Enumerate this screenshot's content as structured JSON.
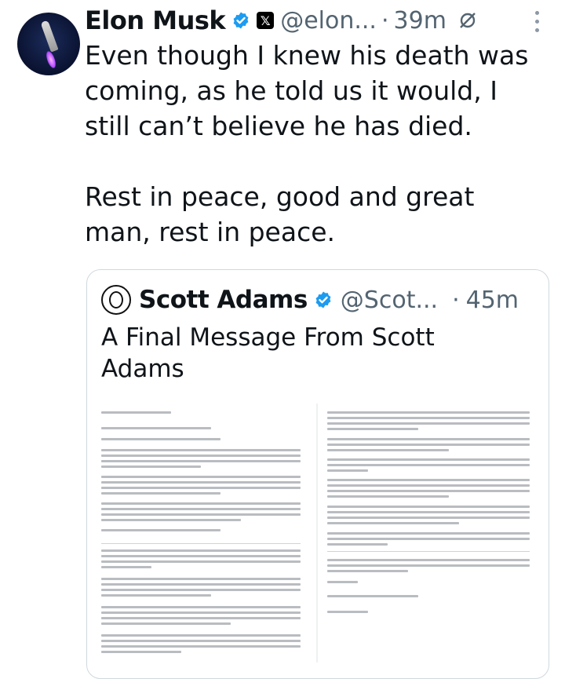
{
  "tweet": {
    "author_name": "Elon Musk",
    "handle": "@elon...",
    "separator": "·",
    "time": "39m",
    "text_lines": [
      "Even though I knew his death was coming, as he told us it would, I still can’t believe he has died.",
      "Rest in peace, good and great man, rest in peace."
    ],
    "icons": {
      "verified": "verified-badge-icon",
      "affiliation": "x-logo-icon",
      "hidden": "eye-slash-icon",
      "more": "more-options-icon"
    }
  },
  "quote": {
    "author_name": "Scott Adams",
    "handle": "@Scot...",
    "separator": "·",
    "time": "45m",
    "text": "A Final Message From Scott Adams",
    "document_title": "A Final Message From Scott Adams",
    "document_closing": "Scott Adams"
  },
  "colors": {
    "text": "#0f1419",
    "muted": "#536471",
    "verified": "#1d9bf0",
    "border": "#cfd9de"
  }
}
